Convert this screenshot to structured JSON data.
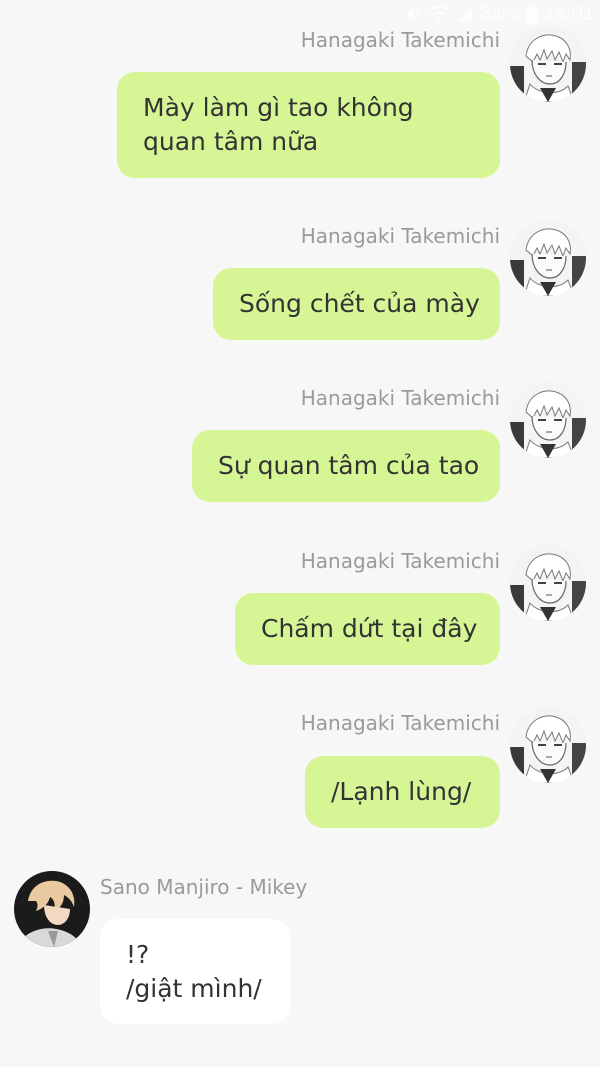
{
  "status_bar": {
    "battery_percent": "84%",
    "time": "14:01",
    "icons": [
      "mute-icon",
      "wifi-icon",
      "signal-icon",
      "battery-icon"
    ]
  },
  "contacts": {
    "me": {
      "name": "Hanagaki Takemichi",
      "avatar": "manga-boy-avatar"
    },
    "other": {
      "name": "Sano Manjiro - Mikey",
      "avatar": "blond-boy-avatar"
    }
  },
  "messages": [
    {
      "sender": "Hanagaki Takemichi",
      "lines": [
        "Mày làm gì tao không",
        "quan tâm nữa"
      ]
    },
    {
      "sender": "Hanagaki Takemichi",
      "lines": [
        "Sống chết của mày"
      ]
    },
    {
      "sender": "Hanagaki Takemichi",
      "lines": [
        "Sự quan tâm của tao"
      ]
    },
    {
      "sender": "Hanagaki Takemichi",
      "lines": [
        "Chấm dứt tại đây"
      ]
    },
    {
      "sender": "Hanagaki Takemichi",
      "lines": [
        "/Lạnh lùng/"
      ]
    },
    {
      "sender": "Sano Manjiro - Mikey",
      "lines": [
        "!?",
        "/giật mình/"
      ]
    }
  ],
  "colors": {
    "background": "#f7f7f7",
    "outgoing_bubble": "#d6f696",
    "incoming_bubble": "#ffffff",
    "name_text": "#9a9a9a",
    "message_text": "#333333"
  }
}
